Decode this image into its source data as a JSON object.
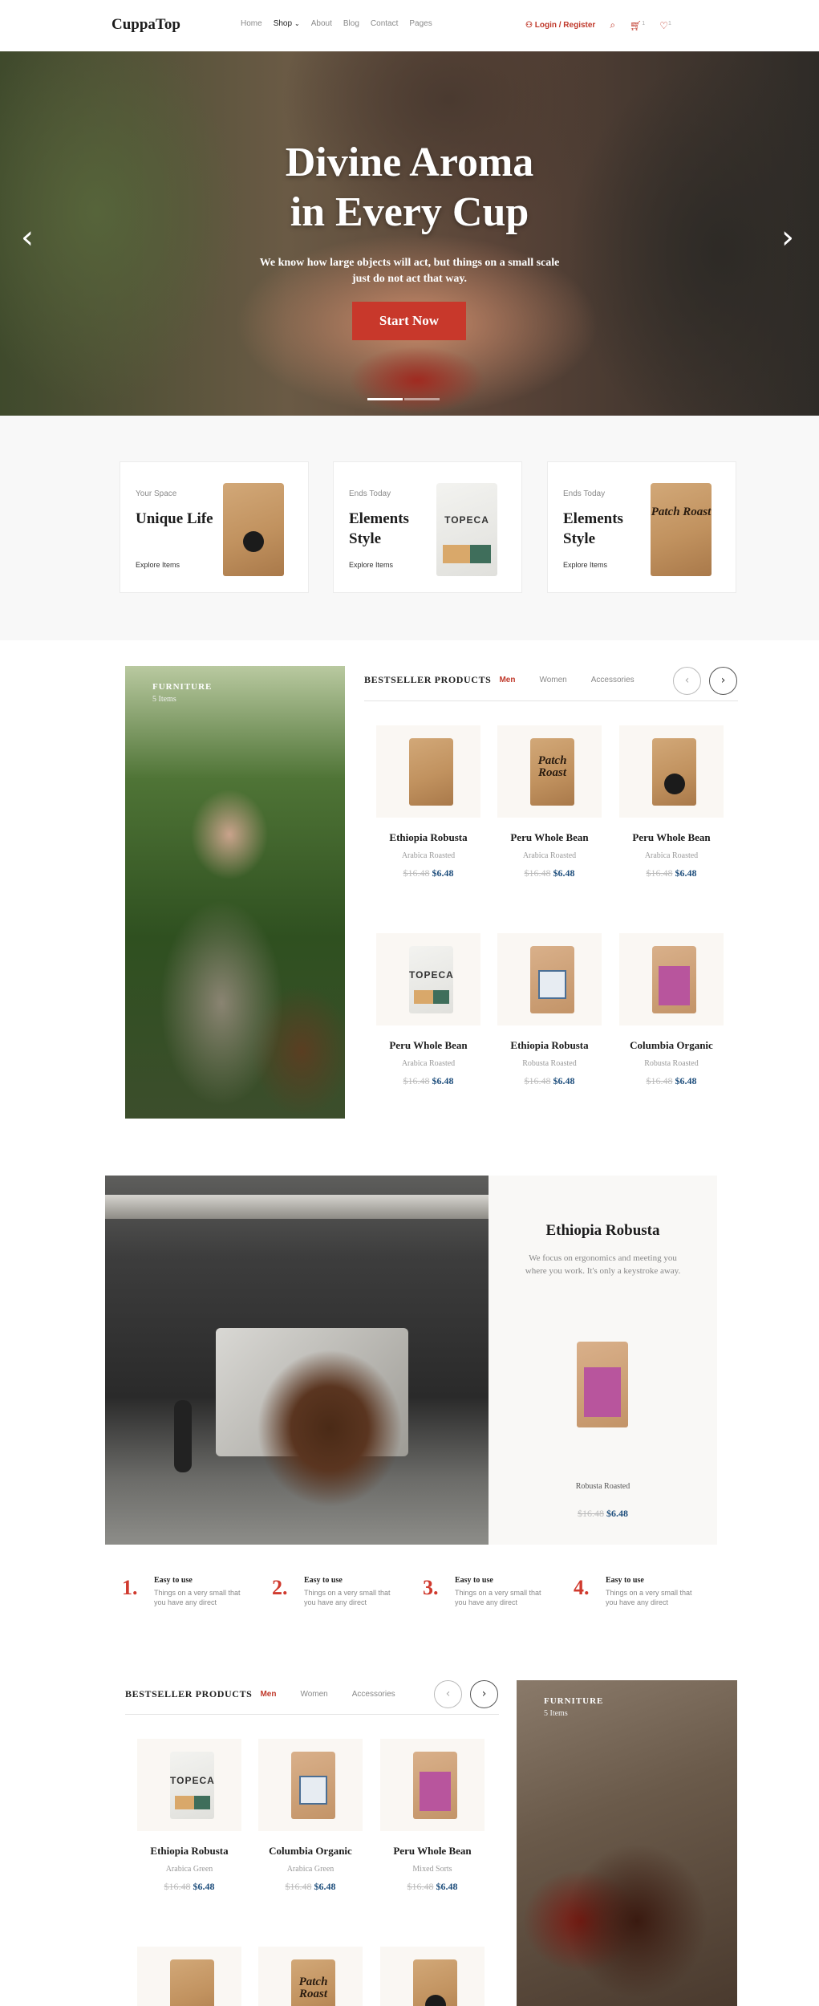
{
  "nav": {
    "logo": "CuppaTop",
    "menu": [
      "Home",
      "Shop",
      "About",
      "Blog",
      "Contact",
      "Pages"
    ],
    "login": "Login / Register",
    "cart_count": "1",
    "wishlist_count": "1"
  },
  "hero": {
    "title_line1": "Divine Aroma",
    "title_line2": "in Every Cup",
    "subtitle": "We know how large objects will act, but things on a small scale just do not act that way.",
    "cta": "Start Now"
  },
  "cards": [
    {
      "kicker": "Your Space",
      "title": "Unique Life",
      "link": "Explore Items"
    },
    {
      "kicker": "Ends Today",
      "title": "Elements Style",
      "link": "Explore Items",
      "bag_brand": "TOPECA"
    },
    {
      "kicker": "Ends Today",
      "title": "Elements Style",
      "link": "Explore Items",
      "bag_script": "Patch Roast"
    }
  ],
  "bestseller1": {
    "promo_caption": "FURNITURE",
    "promo_count": "5 Items",
    "title": "BESTSELLER PRODUCTS",
    "tabs": [
      "Men",
      "Women",
      "Accessories"
    ],
    "products": [
      {
        "name": "Ethiopia Robusta",
        "category": "Arabica Roasted",
        "old_price": "$16.48",
        "price": "$6.48"
      },
      {
        "name": "Peru Whole Bean",
        "category": "Arabica Roasted",
        "old_price": "$16.48",
        "price": "$6.48"
      },
      {
        "name": "Peru Whole Bean",
        "category": "Arabica Roasted",
        "old_price": "$16.48",
        "price": "$6.48"
      },
      {
        "name": "Peru Whole Bean",
        "category": "Arabica Roasted",
        "old_price": "$16.48",
        "price": "$6.48"
      },
      {
        "name": "Ethiopia Robusta",
        "category": "Robusta Roasted",
        "old_price": "$16.48",
        "price": "$6.48"
      },
      {
        "name": "Columbia Organic",
        "category": "Robusta Roasted",
        "old_price": "$16.48",
        "price": "$6.48"
      }
    ]
  },
  "feature": {
    "title": "Ethiopia Robusta",
    "description": "We focus on ergonomics and meeting you where you work. It's only a keystroke away.",
    "category": "Robusta Roasted",
    "old_price": "$16.48",
    "price": "$6.48"
  },
  "steps": [
    {
      "num": "1.",
      "title": "Easy to use",
      "desc": "Things on a very small that you have any direct"
    },
    {
      "num": "2.",
      "title": "Easy to use",
      "desc": "Things on a very small that you have any direct"
    },
    {
      "num": "3.",
      "title": "Easy to use",
      "desc": "Things on a very small that you have any direct"
    },
    {
      "num": "4.",
      "title": "Easy to use",
      "desc": "Things on a very small that you have any direct"
    }
  ],
  "bestseller2": {
    "promo_caption": "FURNITURE",
    "promo_count": "5 Items",
    "title": "BESTSELLER PRODUCTS",
    "tabs": [
      "Men",
      "Women",
      "Accessories"
    ],
    "products": [
      {
        "name": "Ethiopia Robusta",
        "category": "Arabica Green",
        "old_price": "$16.48",
        "price": "$6.48"
      },
      {
        "name": "Columbia Organic",
        "category": "Arabica Green",
        "old_price": "$16.48",
        "price": "$6.48"
      },
      {
        "name": "Peru Whole Bean",
        "category": "Mixed Sorts",
        "old_price": "$16.48",
        "price": "$6.48"
      }
    ],
    "second_row_bag_script": "Patch Roast"
  },
  "colors": {
    "accent": "#c8382b",
    "price_blue": "#1f4f7d"
  }
}
